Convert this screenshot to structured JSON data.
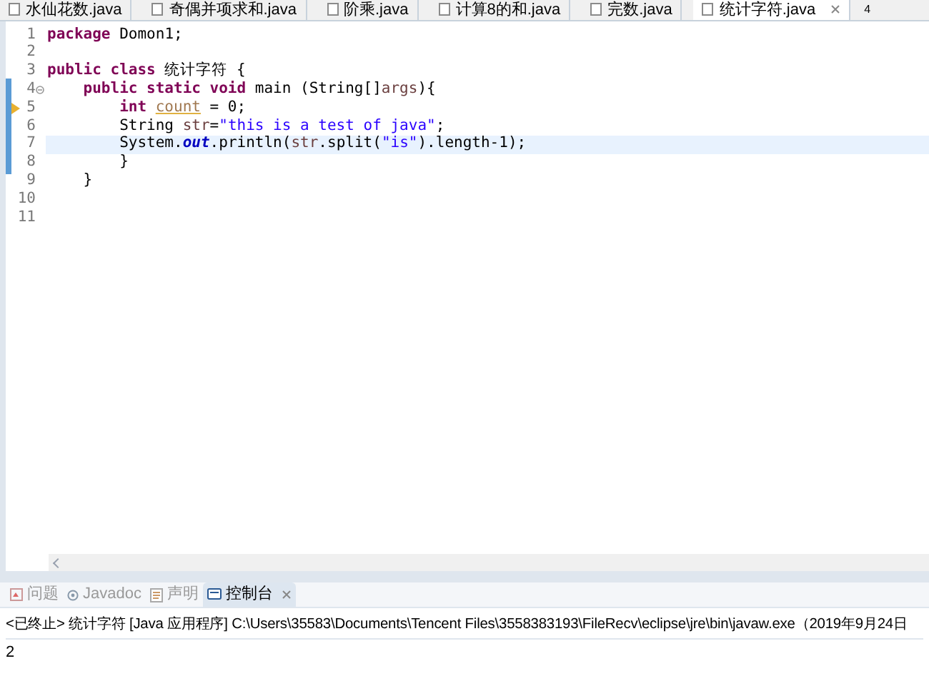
{
  "editor_tabs": [
    {
      "label": "水仙花数.java",
      "selected": false
    },
    {
      "label": "奇偶并项求和.java",
      "selected": false
    },
    {
      "label": "阶乘.java",
      "selected": false
    },
    {
      "label": "计算8的和.java",
      "selected": false
    },
    {
      "label": "完数.java",
      "selected": false
    },
    {
      "label": "统计字符.java",
      "selected": true
    }
  ],
  "hidden_tab_count": "4",
  "code_lines": [
    {
      "number": "1",
      "tokens": [
        {
          "kind": "keyword",
          "text": "package"
        },
        {
          "kind": "plain",
          "text": " Domon1;"
        }
      ]
    },
    {
      "number": "2"
    },
    {
      "number": "3",
      "tokens": [
        {
          "kind": "keyword",
          "text": "public class"
        },
        {
          "kind": "plain",
          "text": " 统计字符 {"
        }
      ]
    },
    {
      "number": "4",
      "fold": true,
      "tokens": [
        {
          "kind": "keyword",
          "text": "    public static void"
        },
        {
          "kind": "plain",
          "text": " main (String[]"
        },
        {
          "kind": "param",
          "text": "args"
        },
        {
          "kind": "plain",
          "text": "){"
        }
      ]
    },
    {
      "number": "5",
      "warning": true,
      "tokens": [
        {
          "kind": "keyword",
          "text": "        int "
        },
        {
          "kind": "unused",
          "text": "count"
        },
        {
          "kind": "plain",
          "text": " = 0;"
        }
      ]
    },
    {
      "number": "6",
      "tokens": [
        {
          "kind": "plain",
          "text": "        String "
        },
        {
          "kind": "param",
          "text": "str"
        },
        {
          "kind": "plain",
          "text": "="
        },
        {
          "kind": "string",
          "text": "\"this is a test of java\""
        },
        {
          "kind": "plain",
          "text": ";"
        }
      ]
    },
    {
      "number": "7",
      "selected": true,
      "tokens": [
        {
          "kind": "plain",
          "text": "        System."
        },
        {
          "kind": "field",
          "text": "out"
        },
        {
          "kind": "plain",
          "text": ".println("
        },
        {
          "kind": "param",
          "text": "str"
        },
        {
          "kind": "plain",
          "text": ".split("
        },
        {
          "kind": "string",
          "text": "\"is\""
        },
        {
          "kind": "plain",
          "text": ").length-1);"
        }
      ]
    },
    {
      "number": "8",
      "tokens": [
        {
          "kind": "plain",
          "text": "        }"
        }
      ]
    },
    {
      "number": "9",
      "tokens": [
        {
          "kind": "plain",
          "text": "    }"
        }
      ]
    },
    {
      "number": "10"
    },
    {
      "number": "11"
    }
  ],
  "panel_tabs": [
    {
      "label": "问题",
      "selected": false
    },
    {
      "label": "Javadoc",
      "selected": false
    },
    {
      "label": "声明",
      "selected": false
    },
    {
      "label": "控制台",
      "selected": true
    }
  ],
  "console": {
    "header": "<已终止> 统计字符 [Java 应用程序] C:\\Users\\35583\\Documents\\Tencent Files\\3558383193\\FileRecv\\eclipse\\jre\\bin\\javaw.exe（2019年9月24日",
    "output": "2"
  }
}
